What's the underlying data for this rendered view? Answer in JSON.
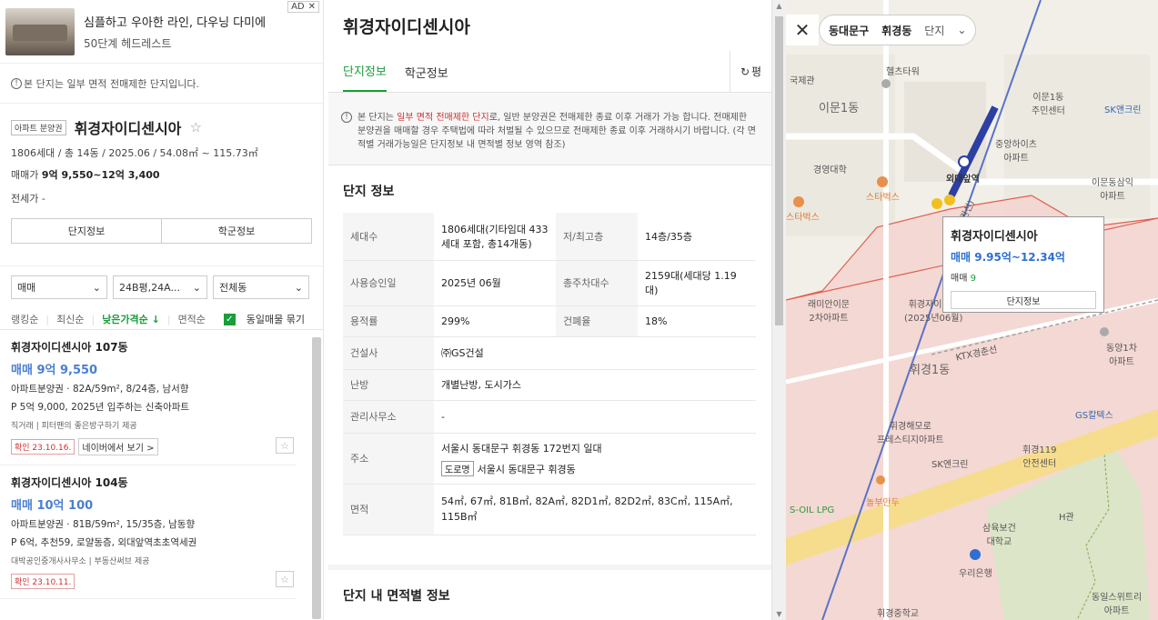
{
  "ad": {
    "title": "심플하고 우아한 라인, 다우닝 다미에",
    "subtitle": "50단계 헤드레스트",
    "badge": "AD",
    "close": "✕"
  },
  "left": {
    "notice": "본 단지는 일부 면적 전매제한 단지입니다.",
    "tag": "아파트 분양권",
    "title": "휘경자이디센시아",
    "meta": "1806세대 / 총 14동 / 2025.06 / 54.08㎡ ~ 115.73㎡",
    "price_label": "매매가",
    "price_value": "9억 9,550~12억 3,400",
    "jeonse": "전세가 -",
    "btn_complex": "단지정보",
    "btn_school": "학군정보",
    "filters": [
      "매매",
      "24B평,24A...",
      "전체동"
    ],
    "sort": [
      "랭킹순",
      "최신순",
      "낮은가격순 ↓",
      "면적순"
    ],
    "checkbox_label": "동일매물 묶기",
    "listings": [
      {
        "name": "휘경자이디센시아 107동",
        "price": "매매 9억 9,550",
        "line1": "아파트분양권 · 82A/59m², 8/24층, 남서향",
        "line2": "P 5억 9,000, 2025년 입주하는 신축아파트",
        "small": "직거래 | 피터팬의 좋은방구하기 제공",
        "confirm": "확인 23.10.16.",
        "link": "네이버에서 보기 >"
      },
      {
        "name": "휘경자이디센시아 104동",
        "price": "매매 10억 100",
        "line1": "아파트분양권 · 81B/59m², 15/35층, 남동향",
        "line2": "P 6억, 추천59, 로얄동층, 외대앞역초초역세권",
        "small": "대박공인중개사사무소 | 부동산써브 제공",
        "confirm": "확인 23.10.11.",
        "link": ""
      }
    ]
  },
  "mid": {
    "title": "휘경자이디센시아",
    "tabs": [
      "단지정보",
      "학군정보"
    ],
    "pyeong": "평",
    "notice_pre": "본 단지는 ",
    "notice_red": "일부 면적 전매제한 단지",
    "notice_post": "로, 일반 분양권은 전매제한 종료 이후 거래가 가능 합니다. 전매제한 분양권을 매매할 경우 주택법에 따라 처벌될 수 있으므로 전매제한 종료 이후 거래하시기 바랍니다. (각 면적별 거래가능일은 단지정보 내 면적별 정보 영역 참조)",
    "section_title": "단지 정보",
    "rows": {
      "households_k": "세대수",
      "households_v": "1806세대(기타임대 433세대 포함, 총14개동)",
      "floors_k": "저/최고층",
      "floors_v": "14층/35층",
      "approval_k": "사용승인일",
      "approval_v": "2025년 06월",
      "parking_k": "총주차대수",
      "parking_v": "2159대(세대당 1.19대)",
      "far_k": "용적률",
      "far_v": "299%",
      "bcr_k": "건폐율",
      "bcr_v": "18%",
      "builder_k": "건설사",
      "builder_v": "㈜GS건설",
      "heating_k": "난방",
      "heating_v": "개별난방, 도시가스",
      "office_k": "관리사무소",
      "office_v": "-",
      "address_k": "주소",
      "address_v": "서울시 동대문구 휘경동 172번지 일대",
      "road_tag": "도로명",
      "road_v": "서울시 동대문구 휘경동",
      "area_k": "면적",
      "area_v": "54㎡, 67㎡, 81B㎡, 82A㎡, 82D1㎡, 82D2㎡, 83C㎡, 115A㎡, 115B㎡"
    },
    "section2_title": "단지 내 면적별 정보"
  },
  "map": {
    "crumbs": [
      "동대문구",
      "휘경동",
      "단지"
    ],
    "popup": {
      "title": "휘경자이디센시아",
      "price": "매매 9.95억~12.34억",
      "count_label": "매매",
      "count": "9",
      "button": "단지정보"
    },
    "labels": {
      "hongsam": "헬츠타워",
      "kukjae": "국제관",
      "imun1": "이문1동",
      "imun1center": "이문1동\n주민센터",
      "sk1": "SK앤크린",
      "jungang": "중앙하이츠\n아파트",
      "kyungyoung": "경영대학",
      "starbucks1": "스타벅스",
      "station": "외대앞역",
      "imundong": "이문동삼익\n아파트",
      "starbucks2": "스타벅스",
      "remian": "래미안이문\n2차아파트",
      "ghost": "휘경자이디센\n(2025년06월)",
      "dongyang": "동양1차\n아파트",
      "hwigyeong1": "휘경1동",
      "ktx": "KTX경춘선",
      "gs": "GS칼텍스",
      "haemoro": "휘경해모로\n프레스티지아파트",
      "hwi119": "휘경119\n안전센터",
      "sk2": "SK엔크린",
      "soil": "S-OIL LPG",
      "nolboo": "놀부만두",
      "sahmyook": "삼육보건\n대학교",
      "hgwan": "H관",
      "woori": "우리은행",
      "school": "휘경중학교",
      "dongil": "동일스위트리\n아파트",
      "line1": "1호선(경원선)"
    }
  }
}
